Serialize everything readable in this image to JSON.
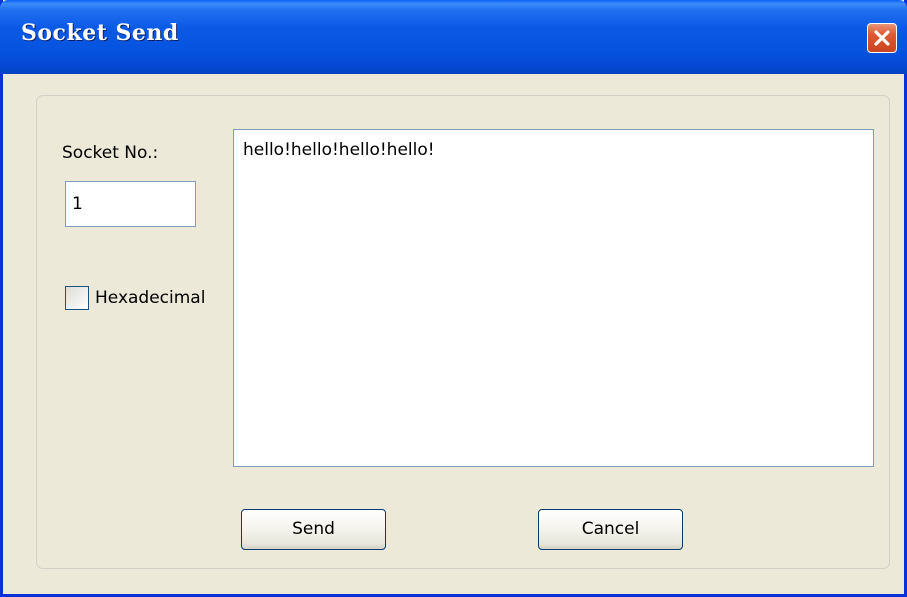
{
  "window": {
    "title": "Socket Send"
  },
  "form": {
    "socket_label": "Socket No.:",
    "socket_value": "1",
    "hex_label": "Hexadecimal",
    "hex_checked": false,
    "message": "hello!hello!hello!hello!"
  },
  "buttons": {
    "send": "Send",
    "cancel": "Cancel"
  },
  "icons": {
    "close": "close-icon",
    "checkbox": "checkbox-unchecked"
  },
  "colors": {
    "titlebar": "#0553df",
    "dialog_bg": "#ece9d8",
    "close_button": "#e05b34",
    "field_border": "#7f9db9"
  }
}
